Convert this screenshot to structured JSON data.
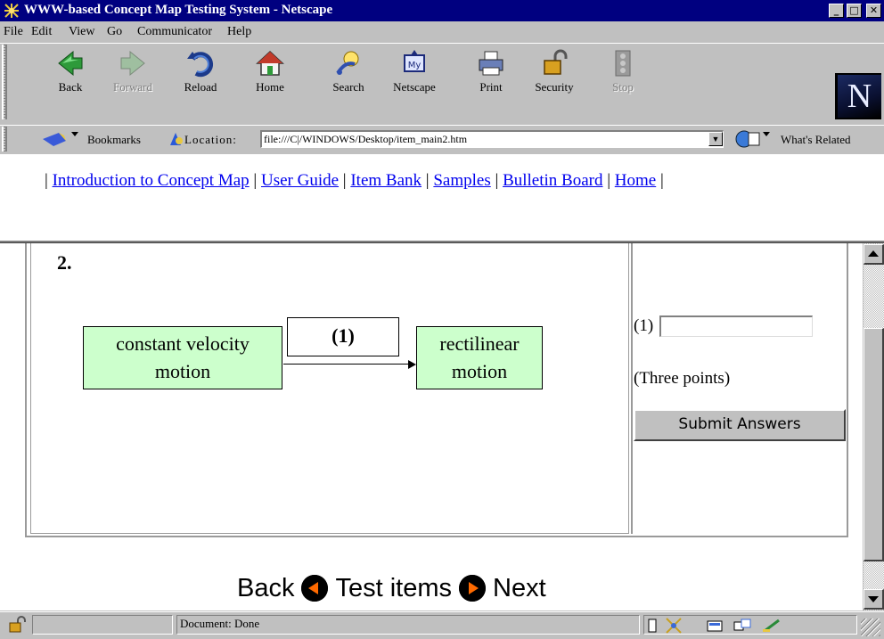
{
  "window": {
    "title": "WWW-based Concept Map Testing System - Netscape",
    "buttons": [
      "_",
      "□",
      "✕"
    ]
  },
  "menu": [
    "File",
    "Edit",
    "View",
    "Go",
    "Communicator",
    "Help"
  ],
  "toolbar": [
    {
      "label": "Back",
      "icon": "back-arrow-icon",
      "enabled": true
    },
    {
      "label": "Forward",
      "icon": "forward-arrow-icon",
      "enabled": false
    },
    {
      "label": "Reload",
      "icon": "reload-icon",
      "enabled": true
    },
    {
      "label": "Home",
      "icon": "home-icon",
      "enabled": true
    },
    {
      "label": "Search",
      "icon": "search-icon",
      "enabled": true
    },
    {
      "label": "Netscape",
      "icon": "netscape-icon",
      "enabled": true
    },
    {
      "label": "Print",
      "icon": "print-icon",
      "enabled": true
    },
    {
      "label": "Security",
      "icon": "lock-icon",
      "enabled": true
    },
    {
      "label": "Stop",
      "icon": "stop-icon",
      "enabled": false
    }
  ],
  "logo": "N",
  "location": {
    "bookmarks_label": "Bookmarks",
    "location_label": "Location:",
    "url": "file:///C|/WINDOWS/Desktop/item_main2.htm",
    "whats_related": "What's Related"
  },
  "nav_links": [
    "Introduction to Concept Map",
    "User Guide",
    "Item Bank",
    "Samples",
    "Bulletin Board",
    "Home"
  ],
  "question": {
    "number": "2.",
    "concept_left": [
      "constant velocity",
      "motion"
    ],
    "link_label": "(1)",
    "concept_right": [
      "rectilinear",
      "motion"
    ]
  },
  "answer": {
    "label": "(1)",
    "value": "",
    "points": "(Three points)",
    "submit_label": "Submit Answers"
  },
  "bottom_nav": {
    "back": "Back",
    "middle": "Test items",
    "next": "Next"
  },
  "status": {
    "text": "Document: Done"
  },
  "colors": {
    "titlebar": "#000080",
    "concept_fill": "#ccffcc",
    "link": "#0000ee",
    "nav_arrow": "#ff6a00"
  }
}
